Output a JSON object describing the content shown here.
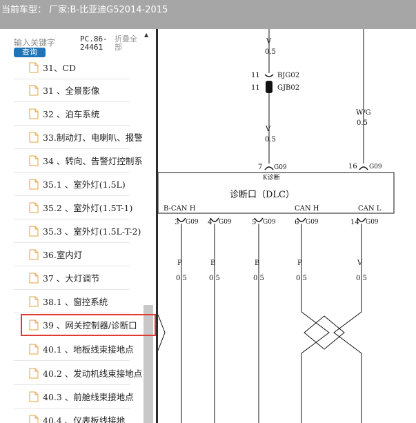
{
  "window": {
    "title": "当前车型： 厂家:B-比亚迪G52014-2015"
  },
  "sidebar": {
    "search": {
      "placeholder": "输入关键字",
      "button_label": "查询"
    },
    "pc_code": "PC.86-24461",
    "collapse_label": "折叠全部",
    "scroll_up_glyph": "▲",
    "items": [
      {
        "label": "31、CD"
      },
      {
        "label": "31 、全景影像"
      },
      {
        "label": "32 、泊车系统"
      },
      {
        "label": "33.制动灯、电喇叭、报警"
      },
      {
        "label": "34 、转向、告警灯控制系"
      },
      {
        "label": "35.1 、室外灯(1.5L)"
      },
      {
        "label": "35.2 、室外灯(1.5T-1)"
      },
      {
        "label": "35.3 、室外灯(1.5L-T-2)"
      },
      {
        "label": "36.室内灯"
      },
      {
        "label": "37 、大灯调节"
      },
      {
        "label": "38.1 、窗控系统"
      },
      {
        "label": "39 、网关控制器/诊断口",
        "selected": true
      },
      {
        "label": "40.1 、地板线束接地点"
      },
      {
        "label": "40.2 、发动机线束接地点"
      },
      {
        "label": "40.3 、前舱线束接地点"
      },
      {
        "label": "40.4 、仪表板线接地"
      }
    ],
    "icon": "document-icon"
  },
  "diagram": {
    "top_wire": {
      "color": "V",
      "gauge": "0.5"
    },
    "connector_top": {
      "pin": "11",
      "name1": "BJG02",
      "name2": "GJB02"
    },
    "mid_wire_left": {
      "color": "V",
      "gauge": "0.5"
    },
    "mid_wire_right": {
      "color": "W/G",
      "gauge": "0.5"
    },
    "pin7": {
      "pin": "7",
      "conn": "G09"
    },
    "pin16": {
      "pin": "16",
      "conn": "G09"
    },
    "box": {
      "small": "K诊断",
      "label": "诊断口（DLC）"
    },
    "bottom_labels": [
      "B-CAN H",
      "CAN H",
      "CAN L"
    ],
    "bottom_pins": [
      {
        "pin": "3",
        "conn": "G09",
        "color": "P",
        "gauge": "0.5"
      },
      {
        "pin": "4",
        "conn": "G09",
        "color": "B",
        "gauge": "0.5"
      },
      {
        "pin": "5",
        "conn": "G09",
        "color": "B",
        "gauge": "0.5"
      },
      {
        "pin": "6",
        "conn": "G09",
        "color": "P",
        "gauge": "0.5"
      },
      {
        "pin": "14",
        "conn": "G09",
        "color": "V",
        "gauge": "0.5"
      }
    ],
    "colors": {
      "selection_border": "#e03a32",
      "button": "#1f73b7",
      "titlebar": "#a6a6a6"
    }
  }
}
